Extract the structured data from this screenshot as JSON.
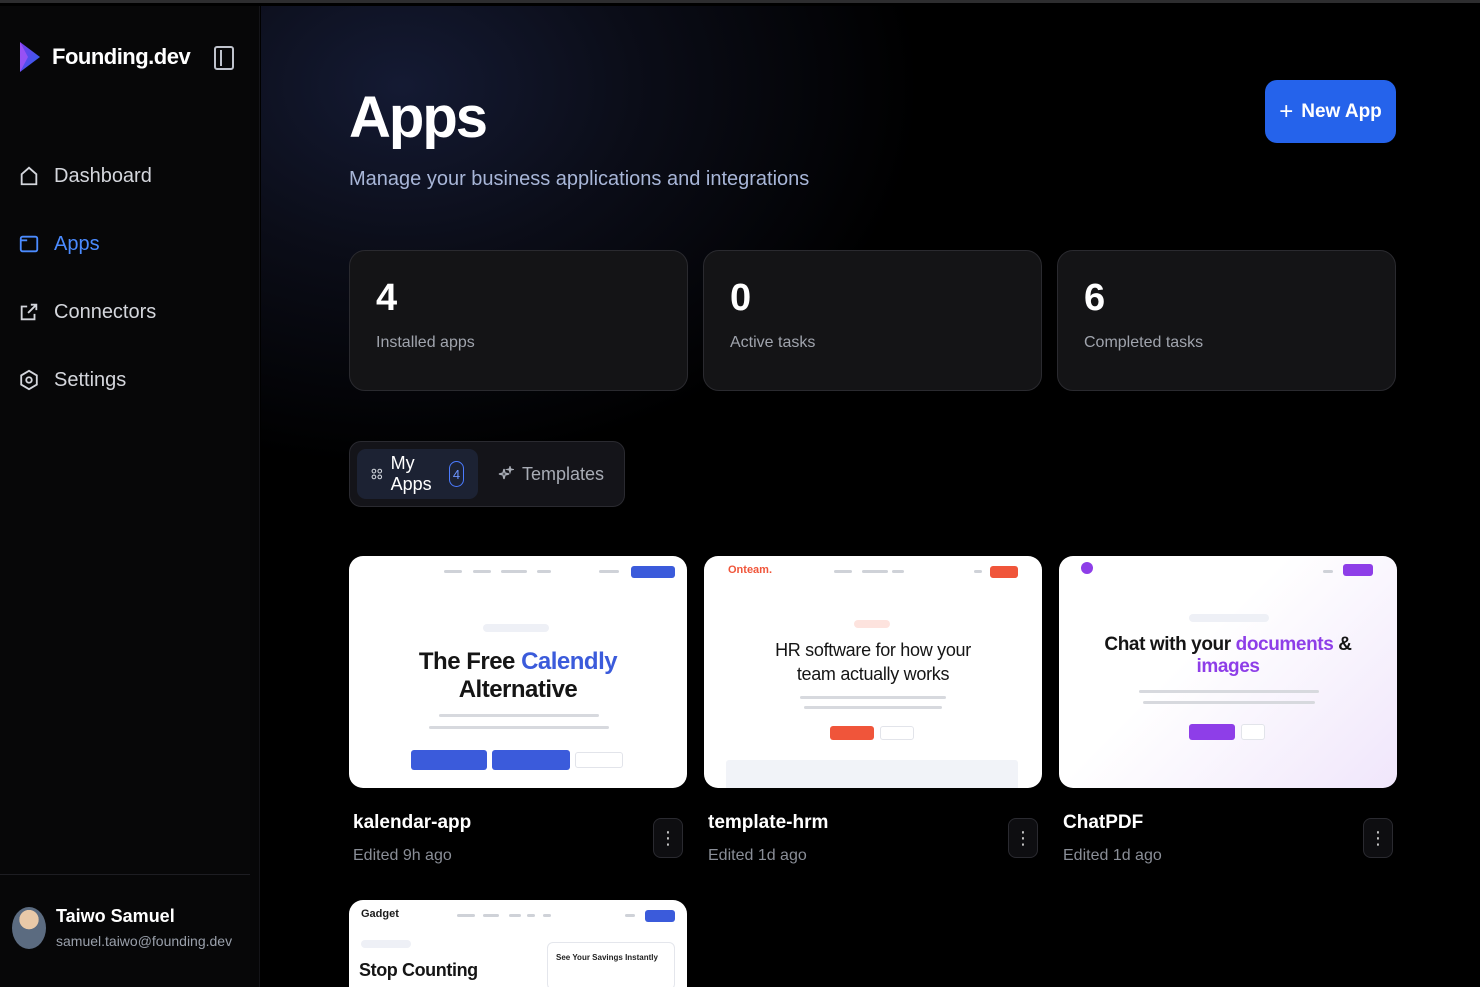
{
  "brand": {
    "name": "Founding.dev"
  },
  "nav": [
    {
      "label": "Dashboard",
      "icon": "home-icon"
    },
    {
      "label": "Apps",
      "icon": "folder-icon",
      "active": true
    },
    {
      "label": "Connectors",
      "icon": "external-link-icon"
    },
    {
      "label": "Settings",
      "icon": "settings-hexagon-icon"
    }
  ],
  "user": {
    "name": "Taiwo Samuel",
    "email": "samuel.taiwo@founding.dev"
  },
  "header": {
    "title": "Apps",
    "subtitle": "Manage your business applications and integrations",
    "new_app_label": "New App"
  },
  "stats": [
    {
      "value": "4",
      "label": "Installed apps"
    },
    {
      "value": "0",
      "label": "Active tasks"
    },
    {
      "value": "6",
      "label": "Completed tasks"
    }
  ],
  "tabs": {
    "my_apps": {
      "label": "My Apps",
      "count": "4"
    },
    "templates": {
      "label": "Templates"
    }
  },
  "apps": [
    {
      "name": "kalendar-app",
      "edited": "Edited 9h ago",
      "preview": {
        "headline_1": "The Free ",
        "headline_accent": "Calendly",
        "headline_2": "Alternative"
      }
    },
    {
      "name": "template-hrm",
      "edited": "Edited 1d ago",
      "preview": {
        "logo": "Onteam.",
        "headline_1": "HR software for how your",
        "headline_2": "team actually works"
      }
    },
    {
      "name": "ChatPDF",
      "edited": "Edited 1d ago",
      "preview": {
        "headline_1": "Chat with your ",
        "headline_accent": "documents",
        "headline_amp": " &",
        "headline_2": "images"
      }
    },
    {
      "name": "",
      "edited": "",
      "preview": {
        "logo": "Gadget",
        "headline_1": "Stop Counting",
        "side_title": "See Your Savings Instantly"
      }
    }
  ],
  "colors": {
    "accent": "#2563eb",
    "active_nav": "#4b8bff",
    "background": "#000000"
  }
}
